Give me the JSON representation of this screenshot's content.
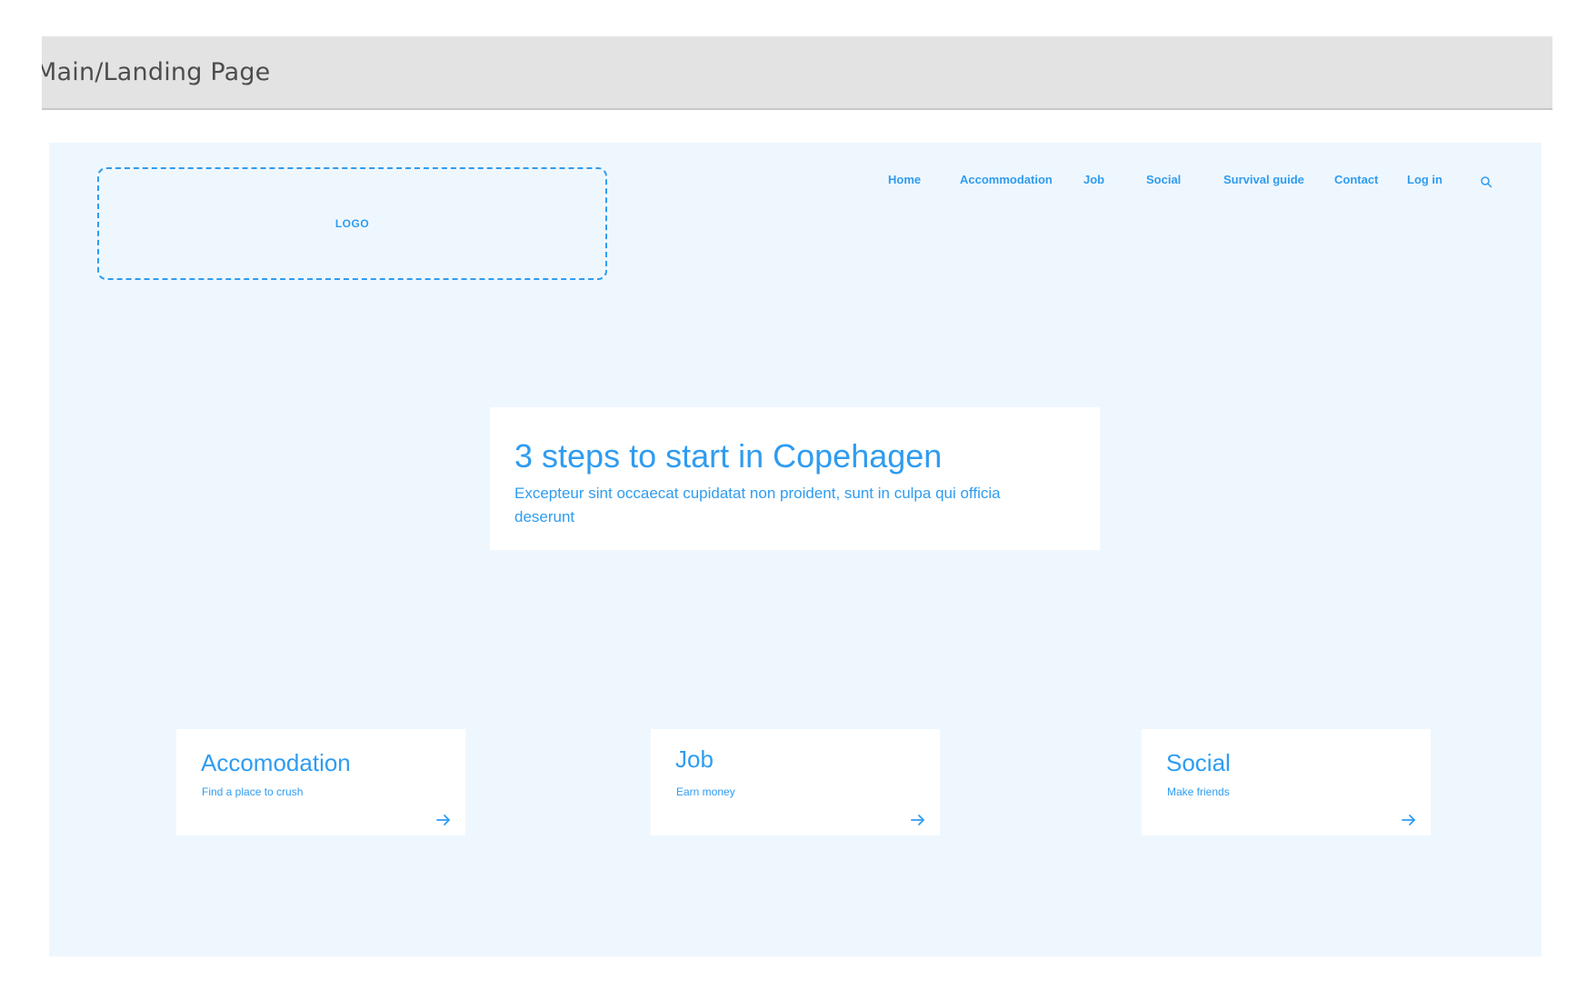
{
  "frame": {
    "title": "Main/Landing Page"
  },
  "logo": {
    "label": "LOGO"
  },
  "nav": {
    "items": [
      {
        "label": "Home"
      },
      {
        "label": "Accommodation"
      },
      {
        "label": "Job"
      },
      {
        "label": "Social"
      },
      {
        "label": "Survival guide"
      },
      {
        "label": "Contact"
      },
      {
        "label": "Log in"
      }
    ],
    "search_icon": "search-icon"
  },
  "hero": {
    "title": "3 steps to start in Copehagen",
    "subtitle": "Excepteur sint occaecat cupidatat non proident, sunt in culpa qui officia deserunt"
  },
  "cards": [
    {
      "title": "Accomodation",
      "subtitle": "Find a place to crush",
      "icon": "arrow-right-icon"
    },
    {
      "title": "Job",
      "subtitle": "Earn money",
      "icon": "arrow-right-icon"
    },
    {
      "title": "Social",
      "subtitle": "Make friends",
      "icon": "arrow-right-icon"
    }
  ],
  "colors": {
    "accent": "#2f9cf0",
    "canvas_background": "#eff7fe",
    "frame_header_background": "#e3e3e3"
  }
}
